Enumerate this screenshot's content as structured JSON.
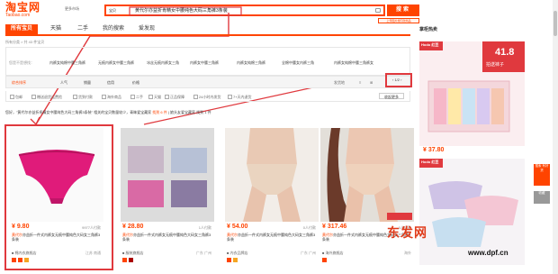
{
  "header": {
    "logo_cn": "淘宝网",
    "logo_en": "Taobao.com",
    "city": "更多市场",
    "search_type": "宝贝",
    "search_query": "黄代尔亦益折肯精女中腰纯色大码三角裤3条装",
    "search_button": "搜索",
    "hint": "上传图片搜同款商品"
  },
  "tabs": [
    "所有宝贝",
    "天猫",
    "二手",
    "我的搜索",
    "爱发现"
  ],
  "breadcrumb": "所有分类 > 共 43 件宝贝",
  "filter": {
    "label": "您是不是想找：",
    "items": [
      "内裤女纯棉中腰三角裤",
      "无痕内裤女中腰三角裤",
      "冰丝无痕内裤女三角",
      "内裤女中腰三角裤",
      "内裤女纯棉三角裤",
      "全棉中腰女内裤三角",
      "内裤女纯棉中腰三角裤女"
    ]
  },
  "sort": {
    "items": [
      "综合排序",
      "人气",
      "销量",
      "信用",
      "价格"
    ],
    "right": [
      "发货地",
      "≡",
      "⊞"
    ],
    "pager": "‹ 1/2 ›"
  },
  "checks": [
    "包邮",
    "赠送退货运费险",
    "货到付款",
    "海外商品",
    "二手",
    "天猫",
    "正品保障",
    "24小时内发货",
    "7+天内退货"
  ],
  "checks_button": "收起更多",
  "tip": {
    "text": "您好，\"黄代尔亦益折肯精女中腰纯色大码三角裤3条装\" 相关的宝贝数量较少，青睐爱宝藏家 ",
    "highlight": "找到 6 件",
    "tail": "  |  娘头友爱宝藏家 找到 1 件"
  },
  "products": [
    {
      "price": "¥ 9.80",
      "sold": "9977人付款",
      "title_hl": "黄代尔",
      "title": "亦益折一件式内裤女无痕中腰纯色大码女三角裤3条装",
      "shop": "■ 棉内衣旗舰店",
      "loc": "江苏 南通",
      "badges": 3
    },
    {
      "price": "¥ 28.80",
      "sold": "1人付款",
      "title_hl": "黄代尔",
      "title": "亦益折一件式内裤女无痕中腰纯色大码女三角裤3条装",
      "shop": "■ 服装旗舰店",
      "loc": "广东 广州",
      "badges": 2
    },
    {
      "price": "¥ 54.00",
      "sold": "0人付款",
      "title_hl": "黄代尔",
      "title": "亦益折一件式内裤女无痕中腰纯色大码女三角裤3条装",
      "shop": "■ 内衣品牌店",
      "loc": "广东 广州",
      "badges": 2
    },
    {
      "price": "¥ 317.46",
      "sold": "0人付款",
      "title_hl": "黄代尔",
      "title": "亦益折一件式内裤女无痕中腰纯色大码女三角裤3条装",
      "shop": "■ 海外旗舰店",
      "loc": "海外",
      "badges": 1
    }
  ],
  "right": {
    "title": "掌柜热卖",
    "ad1_brand": "Hodo 红豆",
    "ad1_price_tag": "41.8",
    "ad1_slogan": "拍送袜子",
    "ad1_price": "¥ 37.80",
    "ad2_brand": "Hodo 红豆"
  },
  "side_tools": [
    "搜索 有好 货",
    "收藏"
  ],
  "watermark": {
    "main": "东发网",
    "sub": "www.dpf.cn"
  },
  "colors": {
    "accent": "#ff4400",
    "highlight_box": "#e0393e"
  }
}
